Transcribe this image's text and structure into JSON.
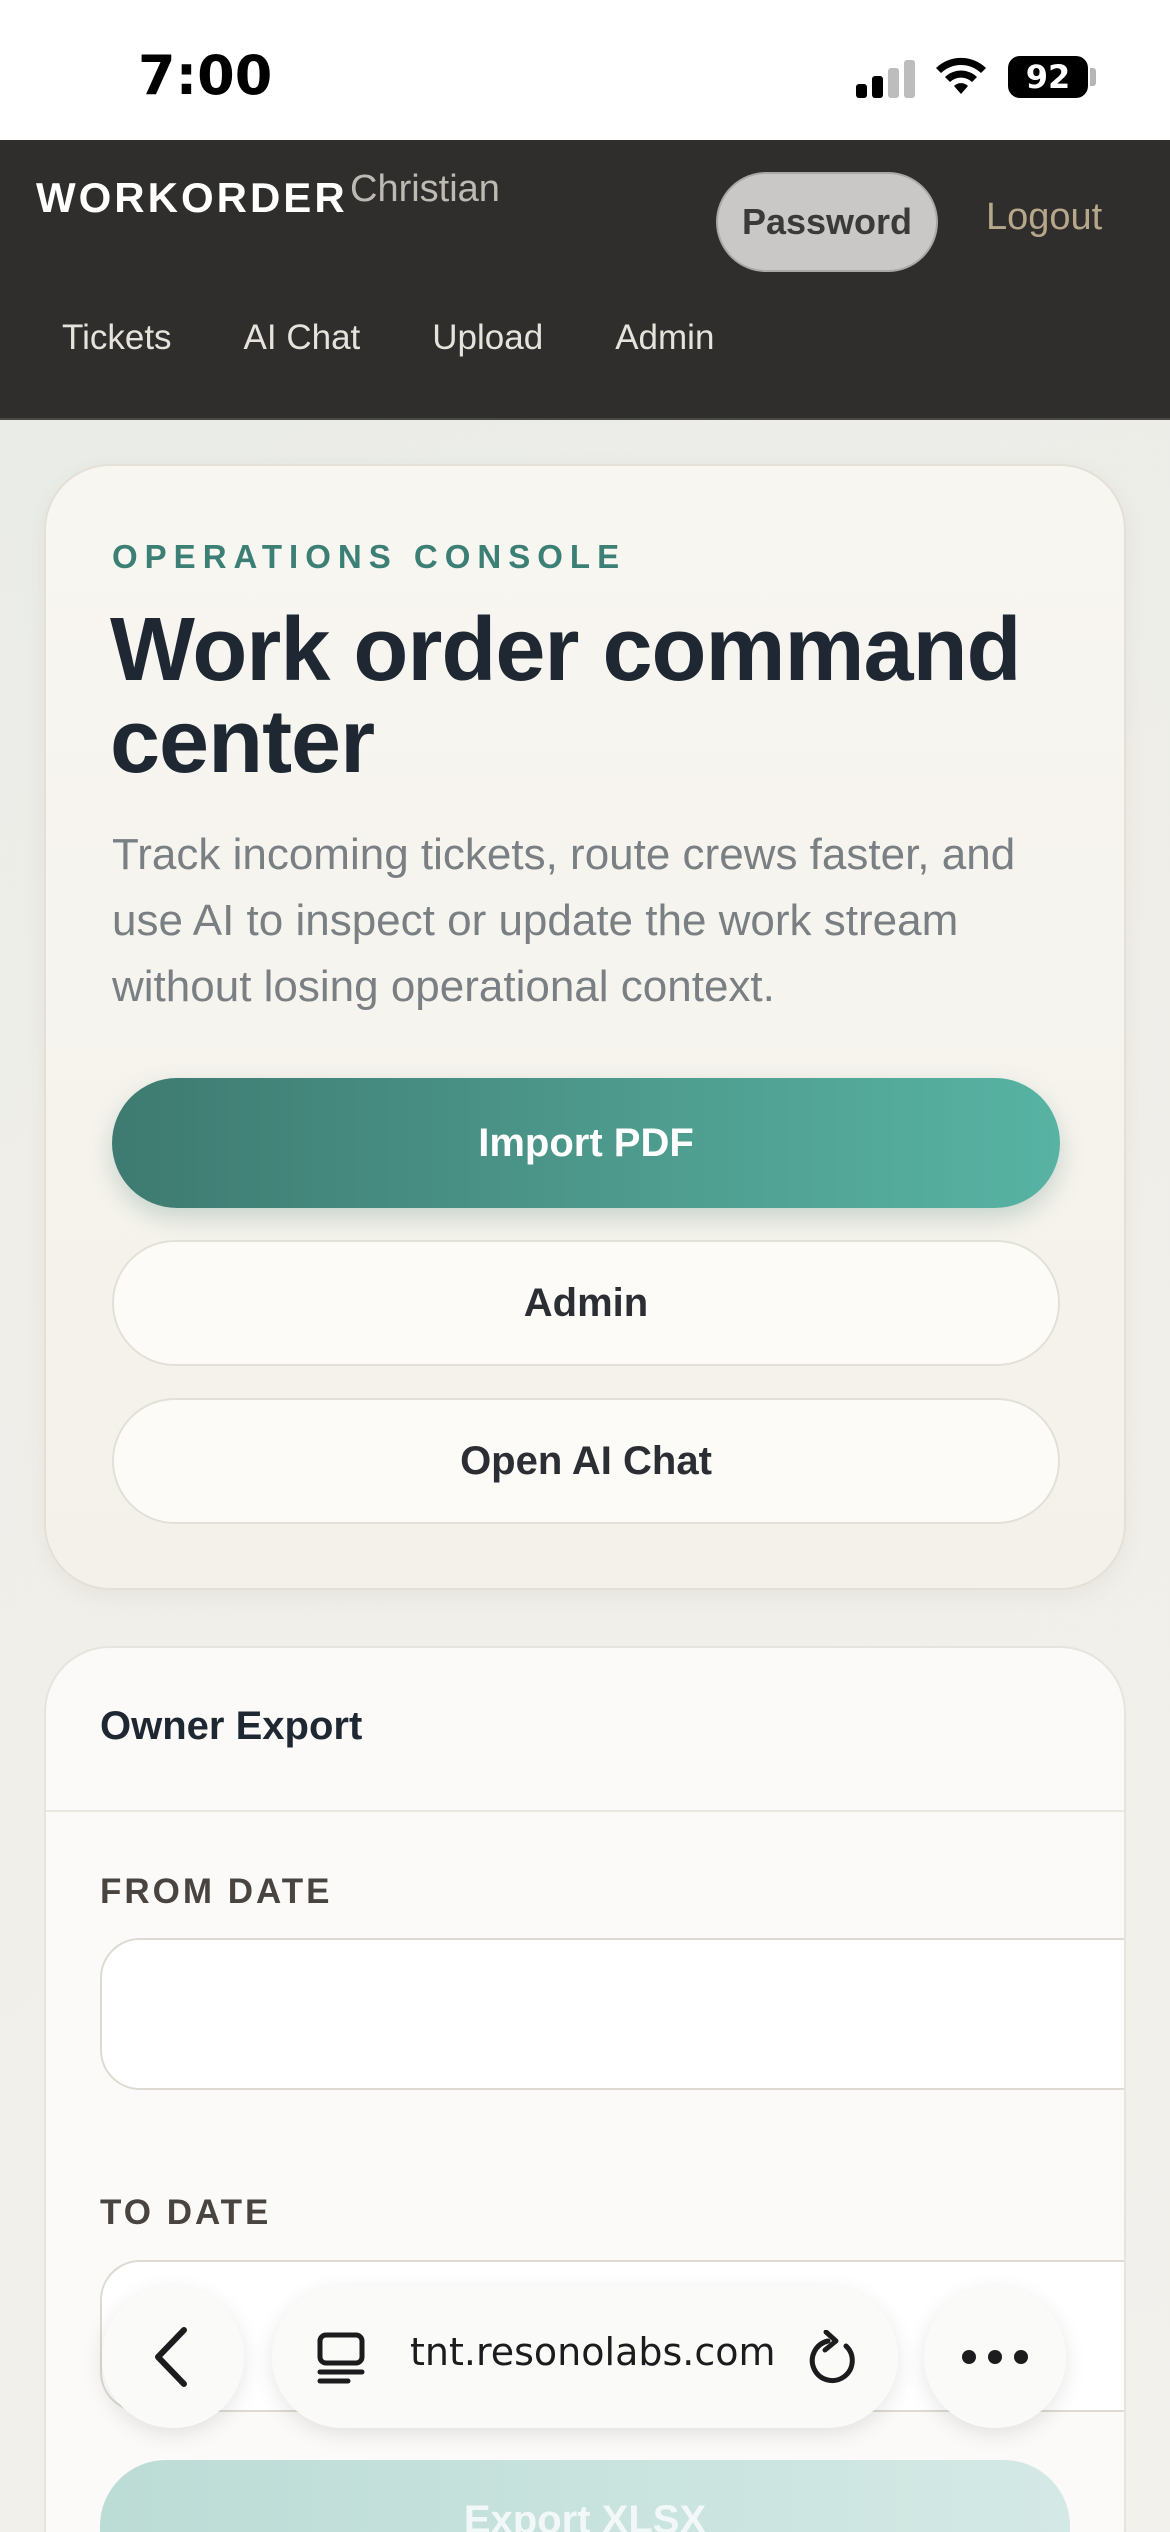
{
  "status_bar": {
    "time": "7:00",
    "battery": "92",
    "icons": [
      "signal-icon",
      "wifi-icon",
      "battery-icon"
    ]
  },
  "header": {
    "brand": "WORKORDER",
    "user": "Christian",
    "password_label": "Password",
    "logout_label": "Logout",
    "nav": [
      {
        "label": "Tickets"
      },
      {
        "label": "AI Chat"
      },
      {
        "label": "Upload"
      },
      {
        "label": "Admin"
      }
    ]
  },
  "hero": {
    "eyebrow": "OPERATIONS CONSOLE",
    "title": "Work order command center",
    "description": "Track incoming tickets, route crews faster, and use AI to inspect or update the work stream without losing operational context.",
    "primary_button": "Import PDF",
    "admin_button": "Admin",
    "chat_button": "Open AI Chat"
  },
  "export": {
    "title": "Owner Export",
    "from_label": "FROM DATE",
    "from_value": "",
    "to_label": "TO DATE",
    "to_value": "",
    "export_button": "Export XLSX"
  },
  "browser": {
    "url": "tnt.resonolabs.com",
    "icons": [
      "back-chevron-icon",
      "tabs-icon",
      "reload-icon",
      "more-icon"
    ]
  },
  "colors": {
    "header_bg": "#2f2e2c",
    "accent_teal": "#3c7f74",
    "primary_button": "#4f9e90",
    "title_text": "#1f2832"
  }
}
